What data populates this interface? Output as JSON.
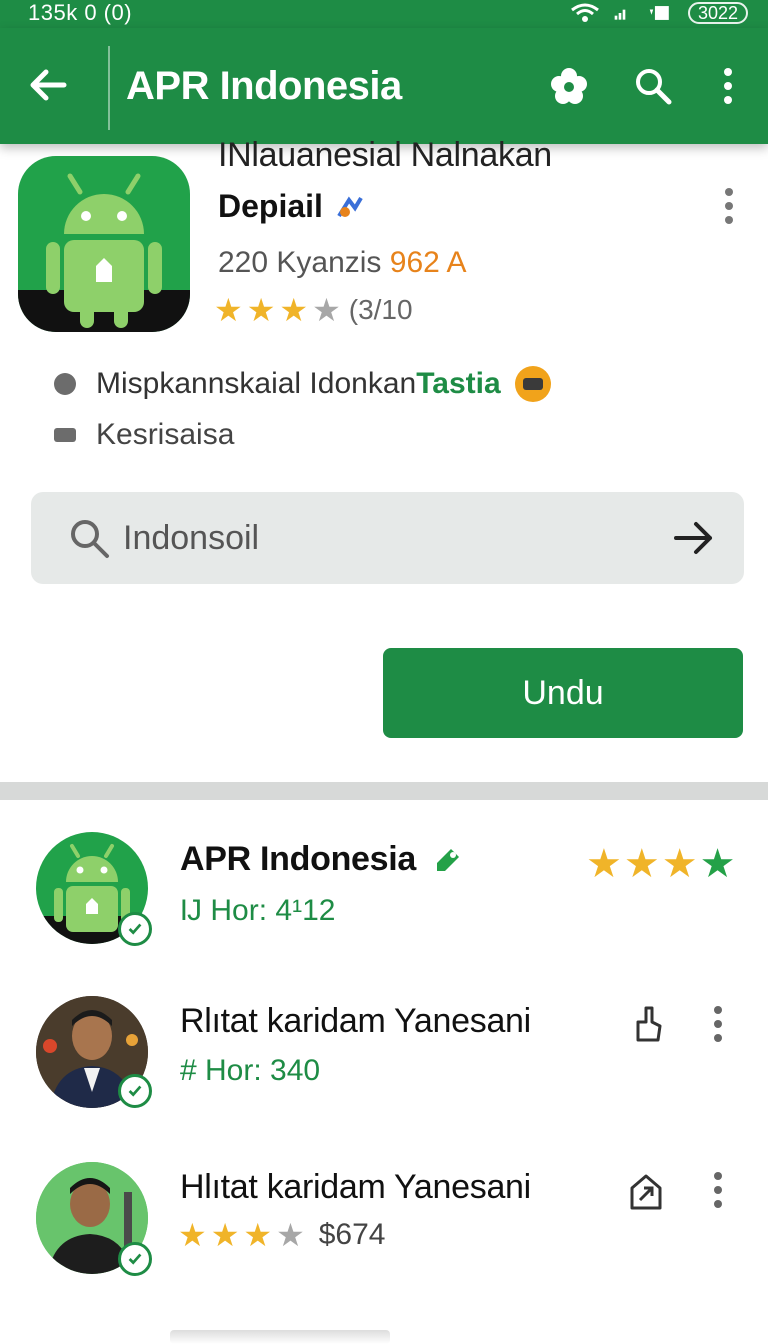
{
  "status_bar": {
    "left_text": "135k 0 (0)",
    "battery": "3022"
  },
  "app_bar": {
    "title": "APR Indonesia"
  },
  "app_header": {
    "cut_title": "INlauanesial Nalnakan",
    "name": "Depiail",
    "meta_prefix": "220 Kyanzis",
    "meta_accent": "962 A",
    "rating_stars": 3.5,
    "rating_text": "(3/10"
  },
  "info": {
    "row1_text": "Mispkannskaial Idonkan",
    "row1_highlight": "Tastia",
    "row2_text": "Kesrisaisa"
  },
  "search": {
    "value": "Indonsoil"
  },
  "download_button": {
    "label": "Undu"
  },
  "list": [
    {
      "title": "APR Indonesia",
      "sub": "Ĳ Hor: 4¹12",
      "stars": 4
    },
    {
      "title": "Rlıtat karidam Yanesani",
      "sub": "# Hor: 340"
    },
    {
      "title": "Hlıtat karidam Yanesani",
      "price": "$674",
      "stars": 3.5
    }
  ],
  "colors": {
    "brand_green": "#1e8c45",
    "star_yellow": "#f0b429",
    "accent_orange": "#e7831b"
  }
}
